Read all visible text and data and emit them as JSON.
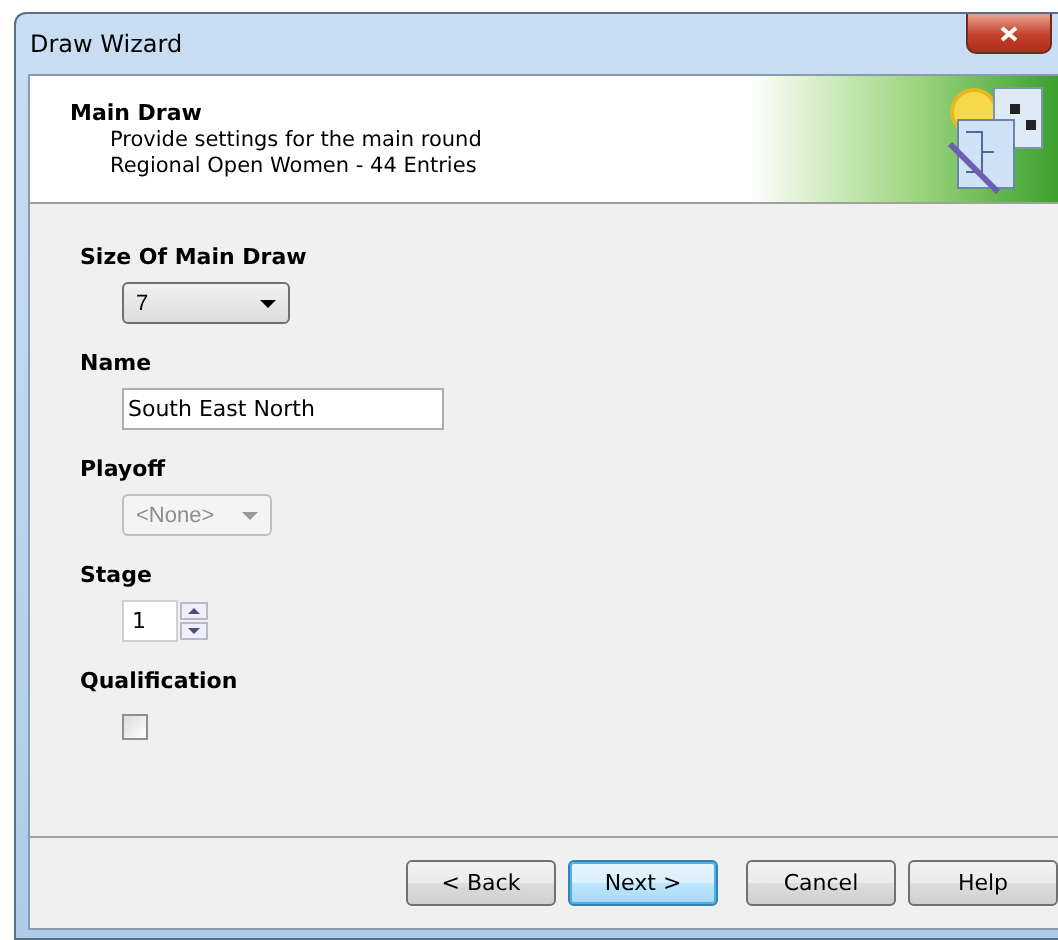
{
  "window": {
    "title": "Draw Wizard"
  },
  "header": {
    "title": "Main Draw",
    "lines": [
      "Provide settings for the main round",
      "Regional Open Women - 44 Entries"
    ]
  },
  "fields": [
    {
      "kind": "dropdown",
      "label": "Size Of Main Draw",
      "value": "7",
      "disabled": false
    },
    {
      "kind": "text",
      "label": "Name",
      "value": "South East North"
    },
    {
      "kind": "dropdown",
      "label": "Playoff",
      "value": "<None>",
      "disabled": true
    },
    {
      "kind": "spinner",
      "label": "Stage",
      "value": "1"
    },
    {
      "kind": "checkbox",
      "label": "Qualification",
      "checked": false
    }
  ],
  "buttons": [
    {
      "label": "< Back",
      "default": false
    },
    {
      "label": "Next >",
      "default": true
    },
    {
      "label": "Cancel",
      "default": false
    },
    {
      "label": "Help",
      "default": false
    }
  ]
}
